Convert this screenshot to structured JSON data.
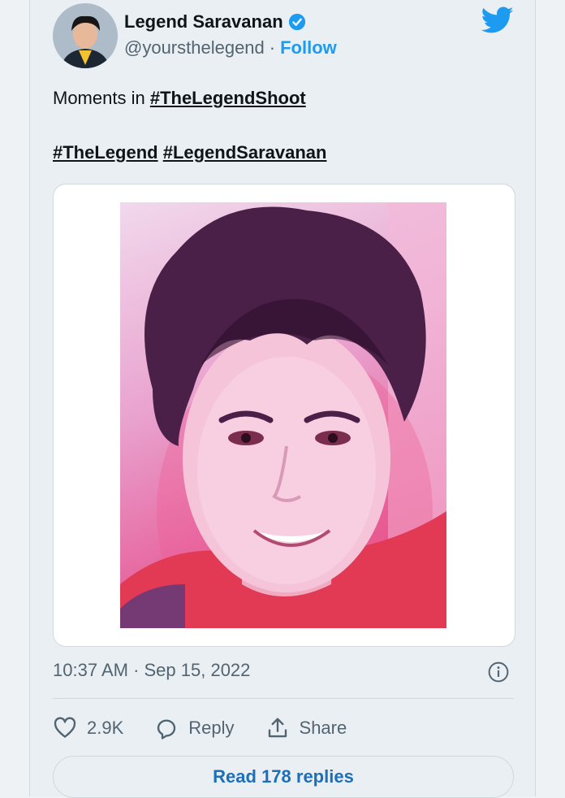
{
  "tweet": {
    "author_name": "Legend Saravanan",
    "handle": "@yoursthelegend",
    "separator": "·",
    "follow_label": "Follow",
    "text_line1_prefix": "Moments in ",
    "hashtag1": "#TheLegendShoot",
    "hashtag2": "#TheLegend",
    "hashtag3": "#LegendSaravanan",
    "timestamp": "10:37 AM · Sep 15, 2022",
    "likes": "2.9K",
    "reply_label": "Reply",
    "share_label": "Share",
    "read_replies_label": "Read 178 replies"
  },
  "icons": {
    "brand": "twitter-bird-icon",
    "verified": "verified-badge-icon",
    "info": "info-icon",
    "like": "heart-icon",
    "reply": "speech-bubble-icon",
    "share": "share-upload-icon"
  },
  "colors": {
    "accent": "#1d9bf0",
    "link_button_text": "#1d6fb8",
    "text_primary": "#0f1419",
    "text_secondary": "#536471",
    "background": "#eaeff3"
  }
}
